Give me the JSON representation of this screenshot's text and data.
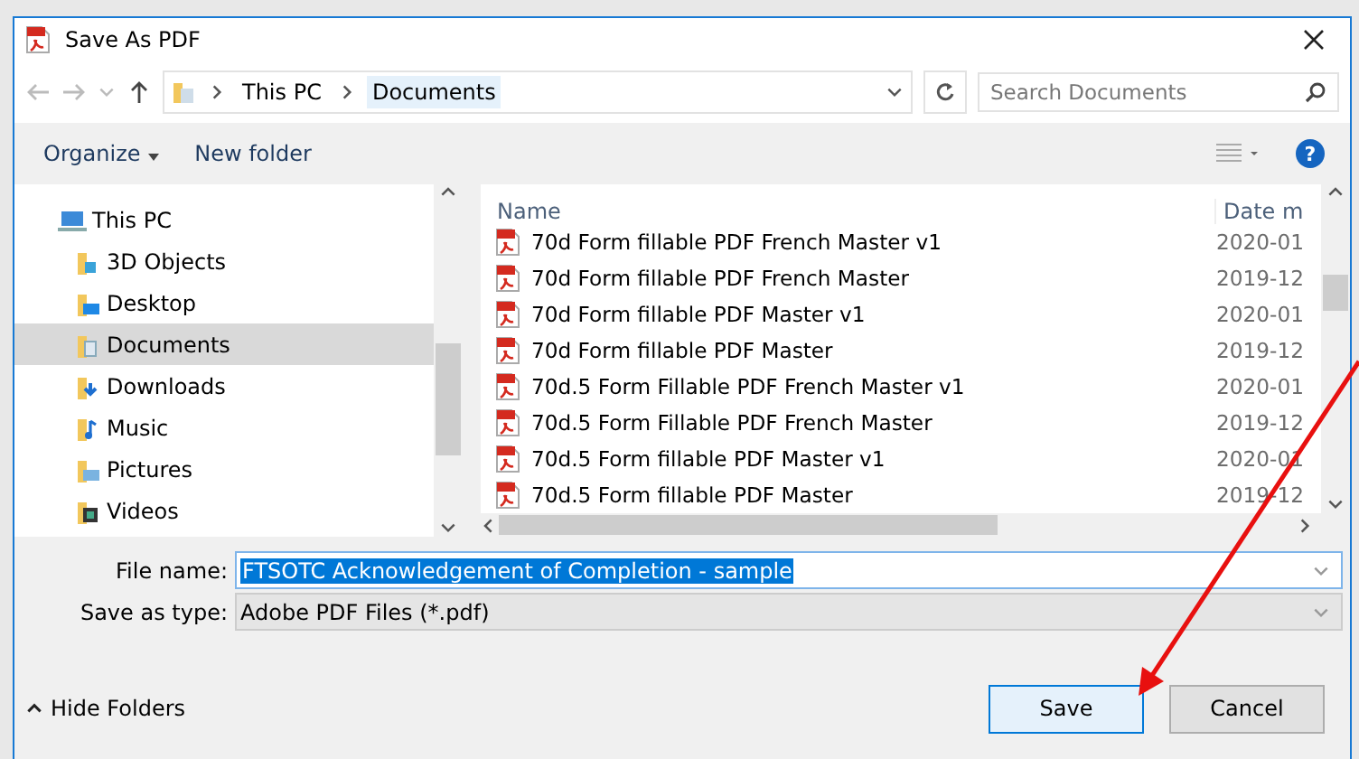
{
  "window": {
    "title": "Save As PDF"
  },
  "breadcrumb": [
    "This PC",
    "Documents"
  ],
  "search": {
    "placeholder": "Search Documents"
  },
  "toolbar": {
    "organize": "Organize",
    "new_folder": "New folder",
    "help": "?"
  },
  "sidebar": {
    "items": [
      {
        "label": "This PC",
        "selected": false,
        "children": [
          {
            "label": "3D Objects",
            "selected": false
          },
          {
            "label": "Desktop",
            "selected": false
          },
          {
            "label": "Documents",
            "selected": true
          },
          {
            "label": "Downloads",
            "selected": false
          },
          {
            "label": "Music",
            "selected": false
          },
          {
            "label": "Pictures",
            "selected": false
          },
          {
            "label": "Videos",
            "selected": false
          }
        ]
      }
    ]
  },
  "table": {
    "columns": [
      "Name",
      "Date m"
    ],
    "rows": [
      {
        "name": "70d Form fillable PDF French Master v1",
        "date": "2020-01"
      },
      {
        "name": "70d Form fillable PDF French Master",
        "date": "2019-12"
      },
      {
        "name": "70d Form fillable PDF Master v1",
        "date": "2020-01"
      },
      {
        "name": "70d Form fillable PDF Master",
        "date": "2019-12"
      },
      {
        "name": "70d.5 Form Fillable PDF French Master v1",
        "date": "2020-01"
      },
      {
        "name": "70d.5 Form Fillable PDF French Master",
        "date": "2019-12"
      },
      {
        "name": "70d.5 Form fillable PDF Master v1",
        "date": "2020-01"
      },
      {
        "name": "70d.5 Form fillable PDF Master",
        "date": "2019-12"
      }
    ]
  },
  "form": {
    "file_name_label": "File name:",
    "file_name": "FTSOTC Acknowledgement of Completion - sample",
    "type_label": "Save as type:",
    "type": "Adobe PDF Files (*.pdf)"
  },
  "footer": {
    "hide_folders": "Hide Folders",
    "buttons": [
      {
        "label": "Save",
        "kind": "default"
      },
      {
        "label": "Cancel",
        "kind": "normal"
      }
    ]
  }
}
